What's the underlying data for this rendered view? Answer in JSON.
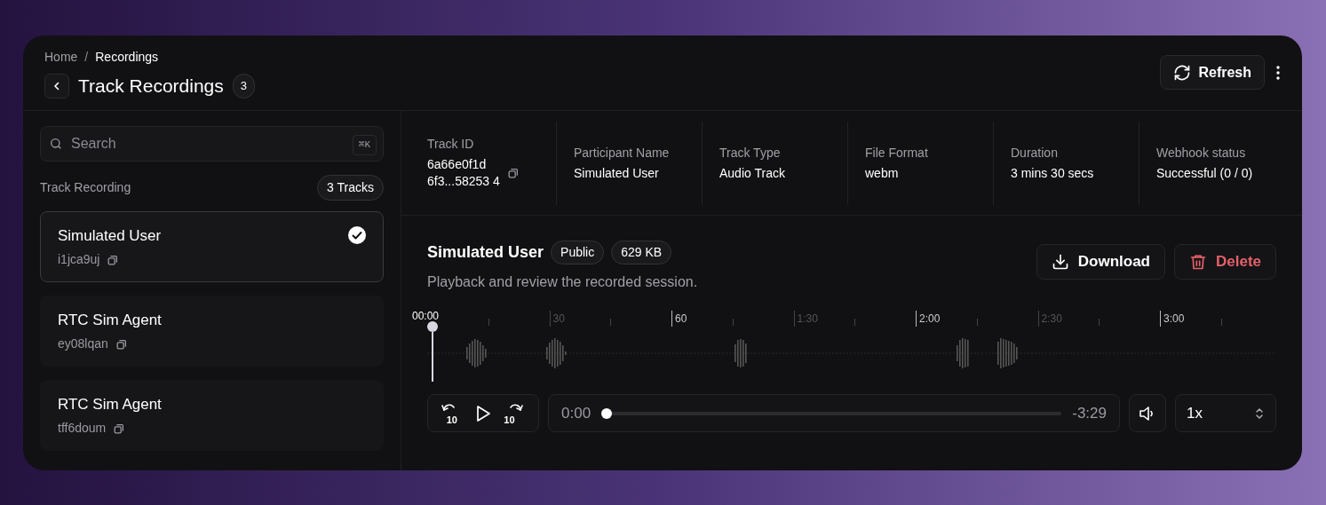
{
  "breadcrumb_separator": "/",
  "breadcrumb": [
    {
      "label": "Home",
      "current": false
    },
    {
      "label": "Recordings",
      "current": true
    }
  ],
  "title": "Track Recordings",
  "title_count": "3",
  "header_actions": {
    "refresh": "Refresh"
  },
  "sidebar": {
    "search": {
      "placeholder": "Search",
      "shortcut": "⌘K"
    },
    "section_label": "Track Recording",
    "count_badge": "3 Tracks",
    "items": [
      {
        "name": "Simulated User",
        "id": "i1jca9uj",
        "selected": true
      },
      {
        "name": "RTC Sim Agent",
        "id": "ey08lqan",
        "selected": false
      },
      {
        "name": "RTC Sim Agent",
        "id": "tff6doum",
        "selected": false
      }
    ]
  },
  "details": [
    {
      "label": "Track ID",
      "value": "6a66e0f1d 6f3...58253 4",
      "copyable": true
    },
    {
      "label": "Participant Name",
      "value": "Simulated User",
      "copyable": false
    },
    {
      "label": "Track Type",
      "value": "Audio Track",
      "copyable": false
    },
    {
      "label": "File Format",
      "value": "webm",
      "copyable": false
    },
    {
      "label": "Duration",
      "value": "3 mins 30 secs",
      "copyable": false
    },
    {
      "label": "Webhook status",
      "value": "Successful (0 / 0)",
      "copyable": false
    }
  ],
  "player": {
    "title": "Simulated User",
    "badges": [
      "Public",
      "629 KB"
    ],
    "subtitle": "Playback and review the recorded session.",
    "actions": [
      {
        "kind": "download",
        "label": "Download"
      },
      {
        "kind": "delete",
        "label": "Delete"
      }
    ],
    "playhead_label": "00:00",
    "ticks": [
      {
        "label": "30",
        "major": false
      },
      {
        "label": "60",
        "major": true
      },
      {
        "label": "1:30",
        "major": false
      },
      {
        "label": "2:00",
        "major": true
      },
      {
        "label": "2:30",
        "major": false
      },
      {
        "label": "3:00",
        "major": true
      }
    ],
    "back_skip": "10",
    "forward_skip": "10",
    "elapsed": "0:00",
    "remaining": "-3:29",
    "level": 0,
    "speed": "1x"
  }
}
